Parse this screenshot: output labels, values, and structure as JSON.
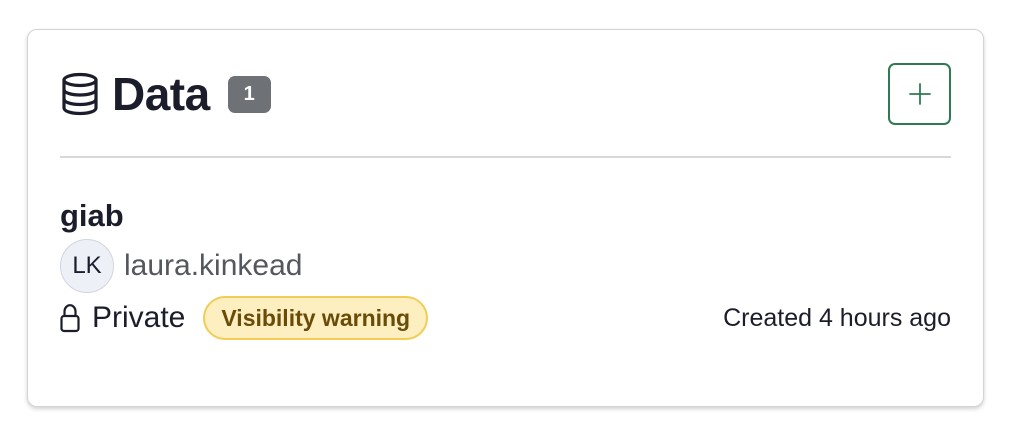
{
  "header": {
    "icon": "database-icon",
    "title": "Data",
    "count": "1",
    "add_button_icon": "plus-icon"
  },
  "item": {
    "name": "giab",
    "owner": {
      "initials": "LK",
      "username": "laura.kinkead"
    },
    "privacy_icon": "lock-icon",
    "privacy": "Private",
    "warning": "Visibility warning",
    "created": "Created 4 hours ago"
  },
  "colors": {
    "accent_green": "#2f7a52",
    "badge_gray": "#6e7175",
    "warning_bg": "#fdefbf",
    "warning_border": "#f1cd55",
    "warning_text": "#6b4b08"
  }
}
